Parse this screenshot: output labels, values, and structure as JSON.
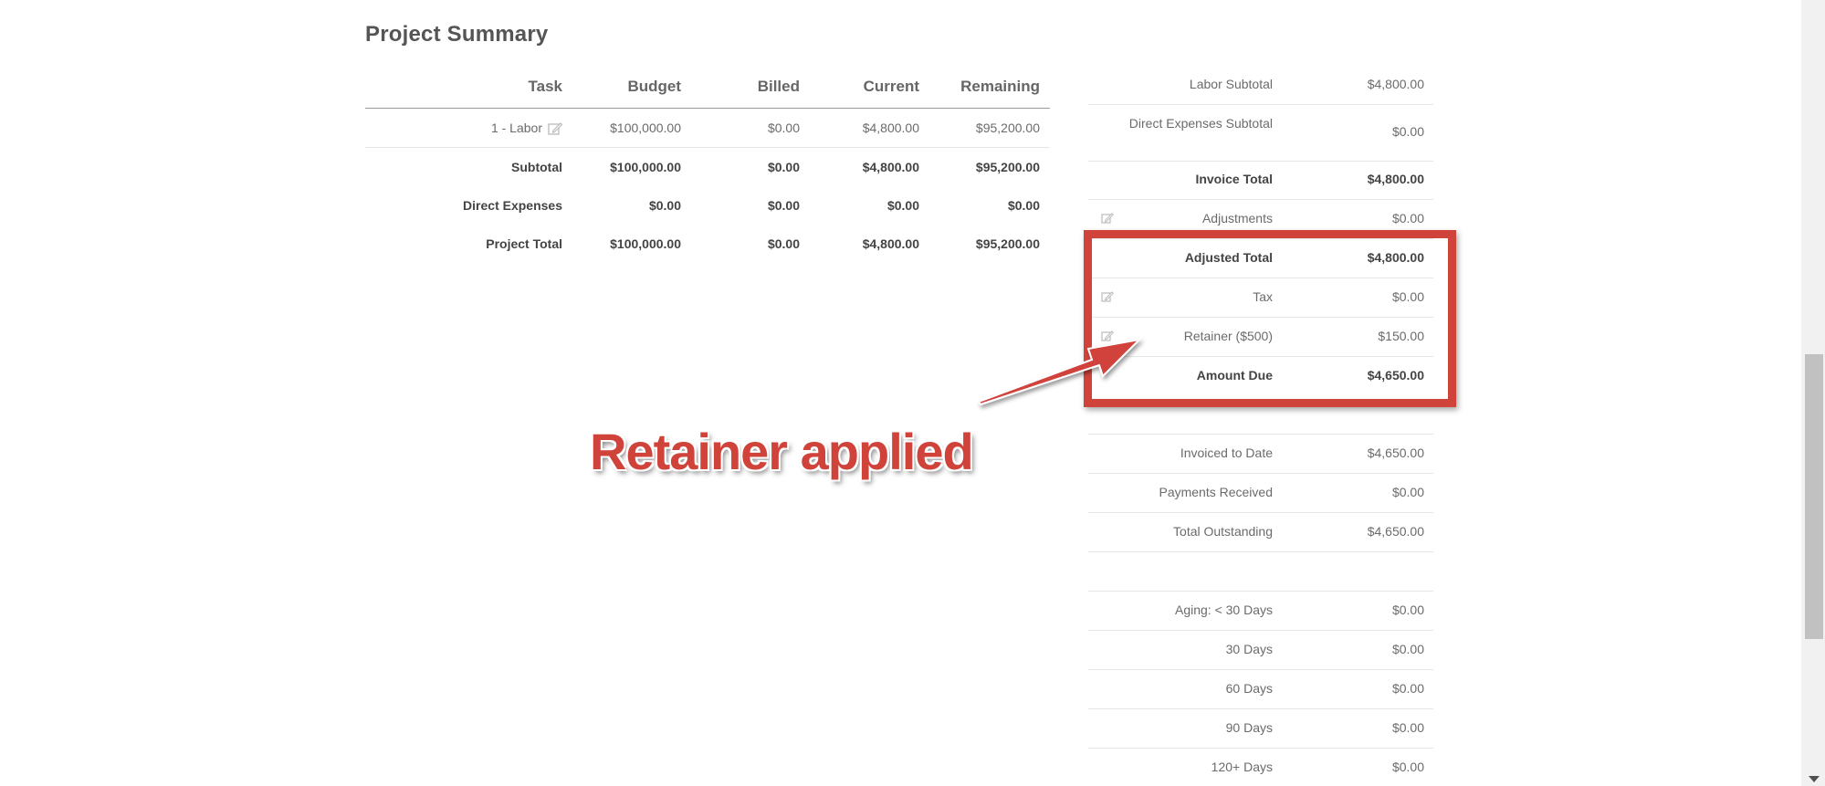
{
  "title": "Project Summary",
  "task_table": {
    "headers": [
      "Task",
      "Budget",
      "Billed",
      "Current",
      "Remaining"
    ],
    "rows": [
      {
        "task": "1 - Labor",
        "budget": "$100,000.00",
        "billed": "$0.00",
        "current": "$4,800.00",
        "remaining": "$95,200.00"
      },
      {
        "task": "Subtotal",
        "budget": "$100,000.00",
        "billed": "$0.00",
        "current": "$4,800.00",
        "remaining": "$95,200.00"
      },
      {
        "task": "Direct Expenses",
        "budget": "$0.00",
        "billed": "$0.00",
        "current": "$0.00",
        "remaining": "$0.00"
      },
      {
        "task": "Project Total",
        "budget": "$100,000.00",
        "billed": "$0.00",
        "current": "$4,800.00",
        "remaining": "$95,200.00"
      }
    ]
  },
  "summary": [
    {
      "label": "Labor Subtotal",
      "value": "$4,800.00"
    },
    {
      "label": "Direct Expenses Subtotal",
      "value": "$0.00"
    },
    {
      "label": "Invoice Total",
      "value": "$4,800.00"
    },
    {
      "label": "Adjustments",
      "value": "$0.00",
      "icon": "edit-icon"
    },
    {
      "label": "Adjusted Total",
      "value": "$4,800.00"
    },
    {
      "label": "Tax",
      "value": "$0.00",
      "icon": "edit-icon"
    },
    {
      "label": "Retainer ($500)",
      "value": "$150.00",
      "icon": "edit-icon"
    },
    {
      "label": "Amount Due",
      "value": "$4,650.00"
    }
  ],
  "totals": [
    {
      "label": "Invoiced to Date",
      "value": "$4,650.00"
    },
    {
      "label": "Payments Received",
      "value": "$0.00"
    },
    {
      "label": "Total Outstanding",
      "value": "$4,650.00"
    }
  ],
  "aging": [
    {
      "label": "Aging: < 30 Days",
      "value": "$0.00"
    },
    {
      "label": "30 Days",
      "value": "$0.00"
    },
    {
      "label": "60 Days",
      "value": "$0.00"
    },
    {
      "label": "90 Days",
      "value": "$0.00"
    },
    {
      "label": "120+ Days",
      "value": "$0.00"
    }
  ],
  "annotation": {
    "text": "Retainer applied",
    "color": "#d0433a"
  }
}
